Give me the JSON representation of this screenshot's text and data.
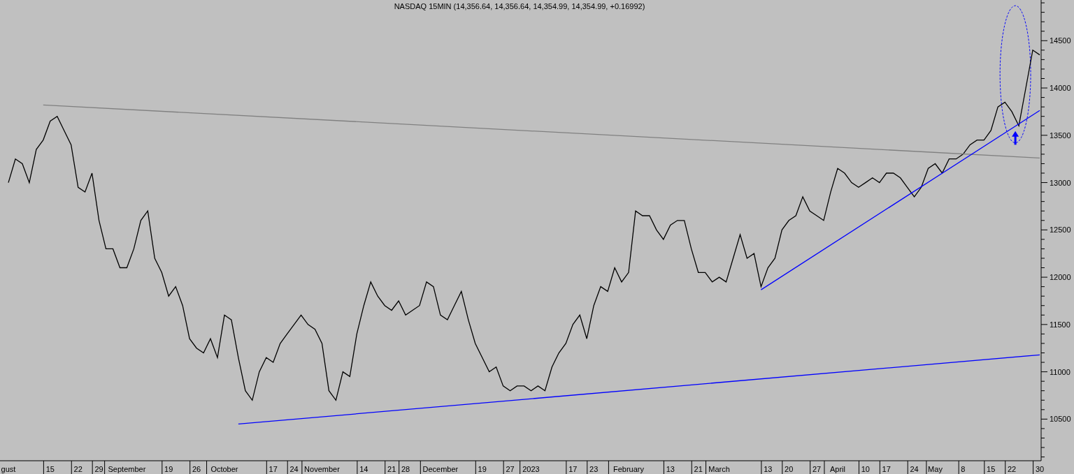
{
  "chart_data": {
    "type": "line",
    "title": "NASDAQ 15MIN (14,356.64, 14,356.64, 14,354.99, 14,354.99, +0.16992)",
    "categories": [
      "gust",
      null,
      null,
      null,
      null,
      null,
      "15",
      null,
      null,
      null,
      "22",
      null,
      null,
      "29",
      null,
      null,
      null,
      "September",
      null,
      null,
      null,
      null,
      null,
      "19",
      null,
      null,
      null,
      "26",
      null,
      null,
      null,
      "October",
      null,
      null,
      null,
      null,
      null,
      null,
      "17",
      null,
      null,
      "24",
      null,
      null,
      null,
      "November",
      null,
      null,
      null,
      null,
      null,
      "14",
      null,
      null,
      null,
      "21",
      null,
      "28",
      null,
      null,
      null,
      null,
      "December",
      null,
      null,
      null,
      null,
      null,
      "19",
      null,
      null,
      null,
      "27",
      null,
      null,
      "2023",
      null,
      null,
      null,
      null,
      null,
      "17",
      null,
      null,
      "23",
      null,
      null,
      null,
      null,
      "February",
      null,
      null,
      null,
      null,
      null,
      "13",
      null,
      null,
      null,
      "21",
      null,
      null,
      "March",
      null,
      null,
      null,
      null,
      null,
      null,
      "13",
      null,
      null,
      "20",
      null,
      null,
      null,
      "27",
      null,
      null,
      "April",
      null,
      null,
      null,
      "10",
      null,
      null,
      "17",
      null,
      null,
      null,
      "24",
      null,
      null,
      "May",
      null,
      null,
      null,
      "8",
      null,
      null,
      null,
      "15",
      null,
      null,
      "22",
      null,
      null,
      null,
      "30"
    ],
    "series": [
      {
        "color": "#000000",
        "values": [
          13000,
          13250,
          13200,
          13000,
          13350,
          13450,
          13650,
          13700,
          13550,
          13400,
          12950,
          12900,
          13100,
          12600,
          12300,
          12300,
          12100,
          12100,
          12300,
          12600,
          12700,
          12200,
          12050,
          11800,
          11900,
          11700,
          11350,
          11250,
          11200,
          11350,
          11150,
          11600,
          11550,
          11150,
          10800,
          10700,
          11000,
          11150,
          11100,
          11300,
          11400,
          11500,
          11600,
          11500,
          11450,
          11300,
          10800,
          10700,
          11000,
          10950,
          11400,
          11700,
          11950,
          11800,
          11700,
          11650,
          11750,
          11600,
          11650,
          11700,
          11950,
          11900,
          11600,
          11550,
          11700,
          11850,
          11550,
          11300,
          11150,
          11000,
          11050,
          10850,
          10800,
          10850,
          10850,
          10800,
          10850,
          10800,
          11050,
          11200,
          11300,
          11500,
          11600,
          11350,
          11700,
          11900,
          11850,
          12100,
          11950,
          12050,
          12700,
          12650,
          12650,
          12500,
          12400,
          12550,
          12600,
          12600,
          12300,
          12050,
          12050,
          11950,
          12000,
          11950,
          12200,
          12450,
          12200,
          12250,
          11900,
          12100,
          12200,
          12500,
          12600,
          12650,
          12850,
          12700,
          12650,
          12600,
          12900,
          13150,
          13100,
          13000,
          12950,
          13000,
          13050,
          13000,
          13100,
          13100,
          13050,
          12950,
          12850,
          12950,
          13150,
          13200,
          13100,
          13250,
          13250,
          13300,
          13400,
          13450,
          13450,
          13550,
          13800,
          13850,
          13750,
          13600,
          14000,
          14400,
          14350
        ]
      },
      {
        "color": "#808080",
        "values": [
          null,
          null,
          null,
          null,
          null,
          13820,
          null,
          null,
          null,
          null,
          null,
          null,
          null,
          null,
          null,
          null,
          null,
          null,
          null,
          null,
          null,
          null,
          null,
          null,
          null,
          null,
          null,
          null,
          null,
          null,
          null,
          null,
          null,
          null,
          null,
          null,
          null,
          null,
          null,
          null,
          null,
          null,
          null,
          null,
          null,
          null,
          null,
          null,
          null,
          null,
          null,
          null,
          null,
          null,
          null,
          null,
          null,
          null,
          null,
          null,
          null,
          null,
          null,
          null,
          null,
          null,
          null,
          null,
          null,
          null,
          null,
          null,
          null,
          null,
          null,
          null,
          null,
          null,
          null,
          null,
          null,
          null,
          null,
          null,
          null,
          null,
          null,
          null,
          null,
          null,
          null,
          null,
          null,
          null,
          null,
          null,
          null,
          null,
          null,
          null,
          null,
          null,
          null,
          null,
          null,
          null,
          null,
          null,
          null,
          null,
          null,
          null,
          null,
          null,
          null,
          null,
          null,
          null,
          null,
          null,
          null,
          null,
          null,
          null,
          null,
          null,
          null,
          null,
          null,
          null,
          null,
          null,
          null,
          null,
          null,
          null,
          null,
          null,
          null,
          null,
          null,
          null,
          null,
          null,
          null,
          null,
          null,
          null,
          13260
        ]
      },
      {
        "color": "#0000ff",
        "values": [
          null,
          null,
          null,
          null,
          null,
          null,
          null,
          null,
          null,
          null,
          null,
          null,
          null,
          null,
          null,
          null,
          null,
          null,
          null,
          null,
          null,
          null,
          null,
          null,
          null,
          null,
          null,
          null,
          null,
          null,
          null,
          null,
          null,
          10448,
          null,
          null,
          null,
          null,
          null,
          null,
          null,
          null,
          null,
          null,
          null,
          null,
          null,
          null,
          null,
          null,
          null,
          null,
          null,
          null,
          null,
          null,
          null,
          null,
          null,
          null,
          null,
          null,
          null,
          null,
          null,
          null,
          null,
          null,
          null,
          null,
          null,
          null,
          null,
          null,
          null,
          null,
          null,
          null,
          null,
          null,
          null,
          null,
          null,
          null,
          null,
          null,
          null,
          null,
          null,
          null,
          null,
          null,
          null,
          null,
          null,
          null,
          null,
          null,
          null,
          null,
          null,
          null,
          null,
          null,
          null,
          null,
          null,
          null,
          null,
          null,
          null,
          null,
          null,
          null,
          null,
          null,
          null,
          null,
          null,
          null,
          null,
          null,
          null,
          null,
          null,
          null,
          null,
          null,
          null,
          null,
          null,
          null,
          null,
          null,
          null,
          null,
          null,
          null,
          null,
          null,
          null,
          null,
          null,
          null,
          null,
          null,
          null,
          null,
          11179
        ]
      },
      {
        "color": "#0000ff",
        "values": [
          null,
          null,
          null,
          null,
          null,
          null,
          null,
          null,
          null,
          null,
          null,
          null,
          null,
          null,
          null,
          null,
          null,
          null,
          null,
          null,
          null,
          null,
          null,
          null,
          null,
          null,
          null,
          null,
          null,
          null,
          null,
          null,
          null,
          null,
          null,
          null,
          null,
          null,
          null,
          null,
          null,
          null,
          null,
          null,
          null,
          null,
          null,
          null,
          null,
          null,
          null,
          null,
          null,
          null,
          null,
          null,
          null,
          null,
          null,
          null,
          null,
          null,
          null,
          null,
          null,
          null,
          null,
          null,
          null,
          null,
          null,
          null,
          null,
          null,
          null,
          null,
          null,
          null,
          null,
          null,
          null,
          null,
          null,
          null,
          null,
          null,
          null,
          null,
          null,
          null,
          null,
          null,
          null,
          null,
          null,
          null,
          null,
          null,
          null,
          null,
          null,
          null,
          null,
          null,
          null,
          null,
          null,
          null,
          11867,
          null,
          null,
          null,
          null,
          null,
          null,
          null,
          null,
          null,
          null,
          null,
          null,
          null,
          null,
          null,
          null,
          null,
          null,
          null,
          null,
          null,
          null,
          null,
          null,
          null,
          null,
          null,
          null,
          null,
          null,
          null,
          null,
          null,
          null,
          null,
          null,
          null,
          null,
          null,
          13762
        ]
      }
    ],
    "ylim": [
      10060,
      14930
    ],
    "yticks": [
      10500,
      11000,
      11500,
      12000,
      12500,
      13000,
      13500,
      14000,
      14500
    ]
  }
}
